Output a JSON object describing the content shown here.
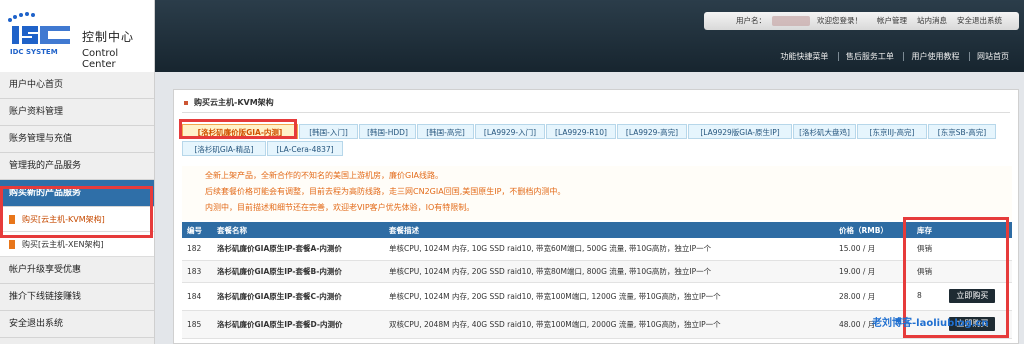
{
  "logo": {
    "title_cn": "控制中心",
    "title_en": "Control Center",
    "mark_text": "IDC SYSTEM"
  },
  "sidebar": {
    "items": [
      {
        "label": "用户中心首页"
      },
      {
        "label": "账户资料管理"
      },
      {
        "label": "账务管理与充值"
      },
      {
        "label": "管理我的产品服务"
      },
      {
        "label": "购买新的产品服务"
      }
    ],
    "sub_items": [
      {
        "label": "购买[云主机-KVM架构]"
      },
      {
        "label": "购买[云主机-XEN架构]"
      }
    ],
    "items_after": [
      {
        "label": "帐户升级享受优惠"
      },
      {
        "label": "推介下线链接赚钱"
      },
      {
        "label": "安全退出系统"
      }
    ]
  },
  "topbar": {
    "user_label": "用户名：",
    "welcome": "欢迎您登录！",
    "account_mgmt": "帐户管理",
    "messages": "站内消息",
    "logout": "安全退出系统",
    "links": [
      "功能快捷菜单",
      "售后服务工单",
      "用户使用教程",
      "网站首页"
    ]
  },
  "section": {
    "title": "购买云主机-KVM架构"
  },
  "tabs": [
    "[洛杉矶廉价版GIA-内测]",
    "[韩国-入门]",
    "[韩国-HDD]",
    "[韩国-高完]",
    "[LA9929-入门]",
    "[LA9929-R10]",
    "[LA9929-高完]",
    "[LA9929版GIA-原生IP]",
    "[洛杉矶大盘鸡]",
    "[东京IIJ-高完]",
    "[东京SB-高完]",
    "[洛杉矶GIA-精品]",
    "[LA-Cera-4837]"
  ],
  "notice": [
    "全新上架产品，全新合作的不知名的美国上游机房，廉价GIA线路。",
    "后续套餐价格可能会有调整，目前去程为高防线路，走三网CN2GIA回国,美国原生IP，不删档内测中。",
    "内测中，目前描述和细节还在完善，欢迎老VIP客户优先体验，IO有特限制。"
  ],
  "table": {
    "headers": [
      "编号",
      "套餐名称",
      "套餐描述",
      "价格（RMB）",
      "库存"
    ],
    "rows": [
      {
        "id": "182",
        "name": "洛杉矶廉价GIA原生IP-套餐A-内测价",
        "desc": "单核CPU, 1024M 内存, 10G SSD raid10, 带宽60M端口, 500G 流量, 带10G高防，独立IP一个",
        "price": "15.00 / 月",
        "stock": "俱销",
        "button": ""
      },
      {
        "id": "183",
        "name": "洛杉矶廉价GIA原生IP-套餐B-内测价",
        "desc": "单核CPU, 1024M 内存, 20G SSD raid10, 带宽80M端口, 800G 流量, 带10G高防，独立IP一个",
        "price": "19.00 / 月",
        "stock": "俱销",
        "button": ""
      },
      {
        "id": "184",
        "name": "洛杉矶廉价GIA原生IP-套餐C-内测价",
        "desc": "单核CPU, 1024M 内存, 20G SSD raid10, 带宽100M端口, 1200G 流量, 带10G高防，独立IP一个",
        "price": "28.00 / 月",
        "stock": "8",
        "button": "立即购买"
      },
      {
        "id": "185",
        "name": "洛杉矶廉价GIA原生IP-套餐D-内测价",
        "desc": "双核CPU, 2048M 内存, 40G SSD raid10, 带宽100M端口, 2000G 流量, 带10G高防，独立IP一个",
        "price": "48.00 / 月",
        "stock": "",
        "button": "立即购买"
      }
    ]
  },
  "watermark": "老刘博客-laoliublog.cn",
  "colors": {
    "highlight": "#e63b3b",
    "header_blue": "#2e6ca4",
    "notice_orange": "#e36b1a"
  }
}
